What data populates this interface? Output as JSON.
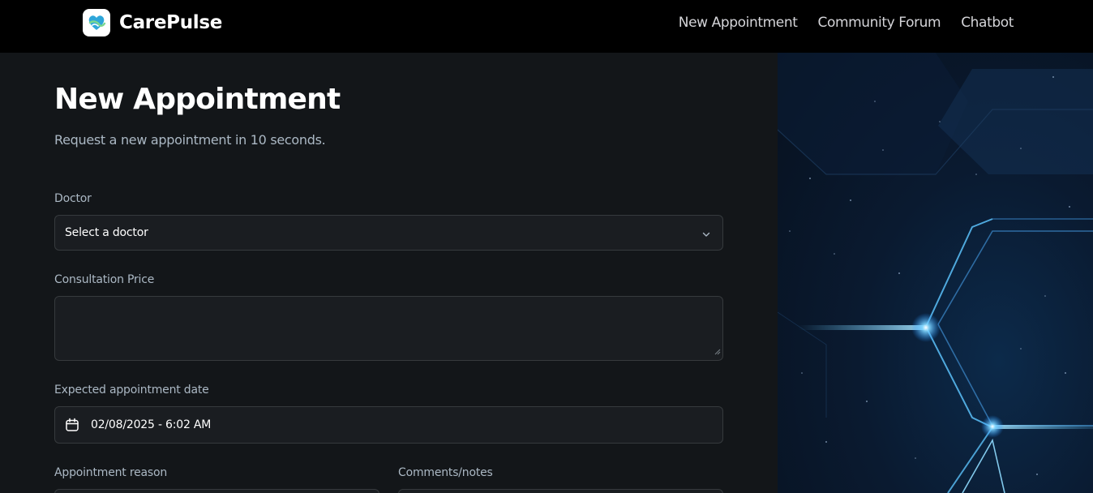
{
  "header": {
    "brand_name": "CarePulse",
    "nav": [
      {
        "label": "New Appointment"
      },
      {
        "label": "Community Forum"
      },
      {
        "label": "Chatbot"
      }
    ]
  },
  "form": {
    "title": "New Appointment",
    "subtitle": "Request a new appointment in 10 seconds.",
    "doctor": {
      "label": "Doctor",
      "value": "Select a doctor"
    },
    "price": {
      "label": "Consultation Price",
      "value": ""
    },
    "date": {
      "label": "Expected appointment date",
      "value": "02/08/2025 - 6:02 AM"
    },
    "reason": {
      "label": "Appointment reason"
    },
    "notes": {
      "label": "Comments/notes"
    }
  },
  "colors": {
    "background": "#131619",
    "topbar": "#000000",
    "field_bg": "#1a1d21",
    "field_border": "#363a3d",
    "label_text": "#abb8c4",
    "accent_glow": "#5fc8ff"
  },
  "icons": {
    "logo": "carepulse-logo-icon",
    "select_chevron": "chevron-down-icon",
    "date": "calendar-icon",
    "resize": "resize-handle-icon"
  }
}
